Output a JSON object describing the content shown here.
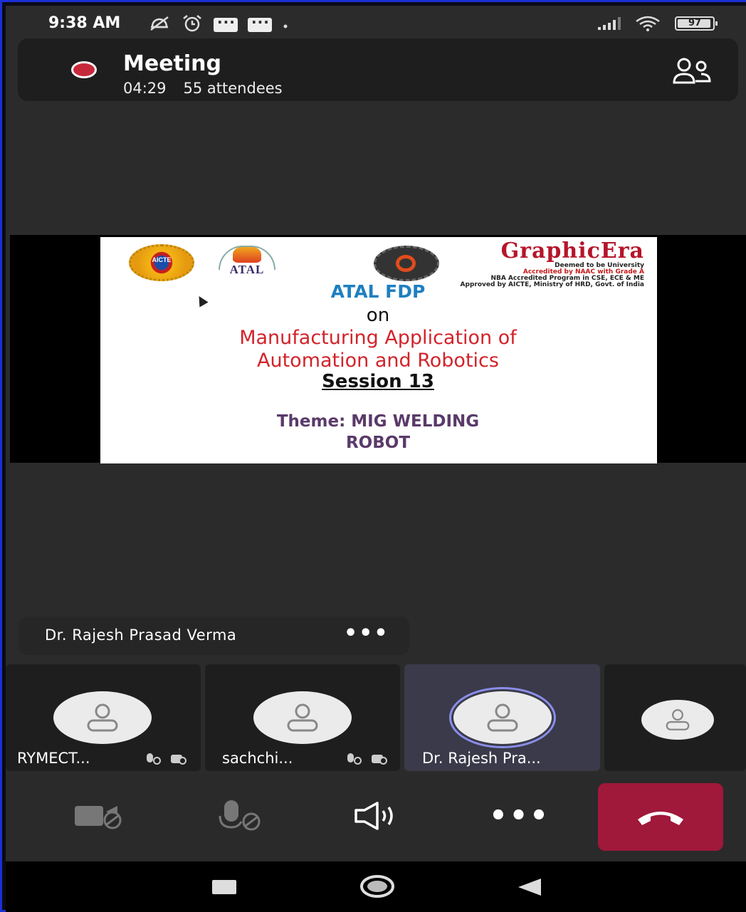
{
  "status_bar": {
    "time": "9:38 AM",
    "battery": "97"
  },
  "meeting": {
    "title": "Meeting",
    "duration": "04:29",
    "attendees": "55 attendees"
  },
  "slide": {
    "logo_aicte_text": "AICTE",
    "logo_atal_text": "ATAL",
    "brand_name": "GraphicEra",
    "brand_line1": "Deemed to be University",
    "brand_line2": "Accredited by NAAC with Grade A",
    "brand_line3": "NBA Accredited Program in CSE, ECE & ME",
    "brand_line4": "Approved by AICTE, Ministry of HRD, Govt. of India",
    "program": "ATAL FDP",
    "on": "on",
    "title_line1": "Manufacturing Application of",
    "title_line2": "Automation and Robotics",
    "session": "Session 13",
    "theme_line1": "Theme: MIG WELDING",
    "theme_line2": "ROBOT"
  },
  "active_speaker": {
    "name": "Dr. Rajesh Prasad Verma",
    "more_label": "•••"
  },
  "participants": [
    {
      "name": "RYMECT..."
    },
    {
      "name": "sachchi..."
    },
    {
      "name": "Dr. Rajesh Pra..."
    },
    {
      "name": ""
    }
  ],
  "controls": {
    "more_label": "•••"
  },
  "colors": {
    "hangup": "#a0183a",
    "record": "#c62a3a",
    "active_ring": "#8a8ee8"
  }
}
